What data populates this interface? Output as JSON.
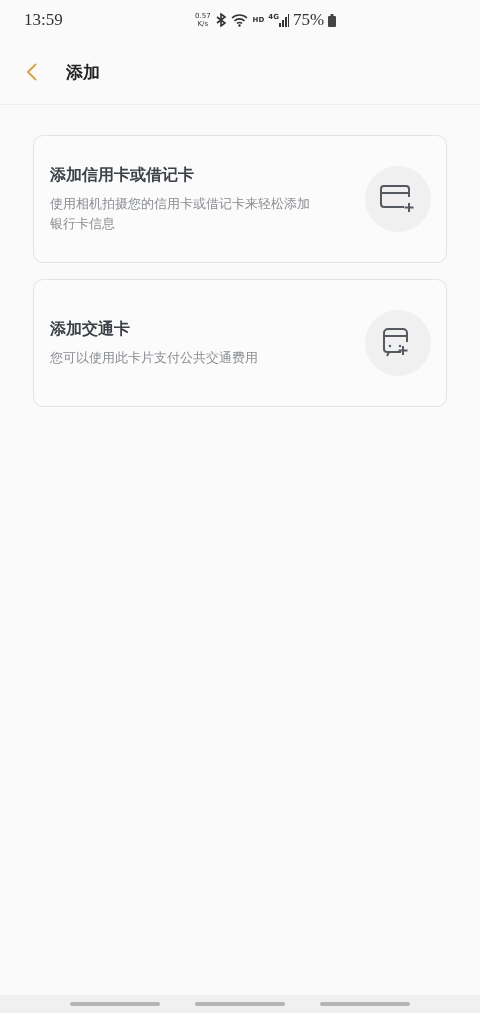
{
  "status_bar": {
    "time": "13:59",
    "speed_value": "0.57",
    "speed_unit": "K/s",
    "network": "HD",
    "cellular": "4G",
    "battery": "75%"
  },
  "header": {
    "title": "添加"
  },
  "cards": [
    {
      "kind": "bank",
      "title": "添加信用卡或借记卡",
      "description": "使用相机拍摄您的信用卡或借记卡来轻松添加银行卡信息"
    },
    {
      "kind": "transit",
      "title": "添加交通卡",
      "description": "您可以使用此卡片支付公共交通费用"
    }
  ]
}
